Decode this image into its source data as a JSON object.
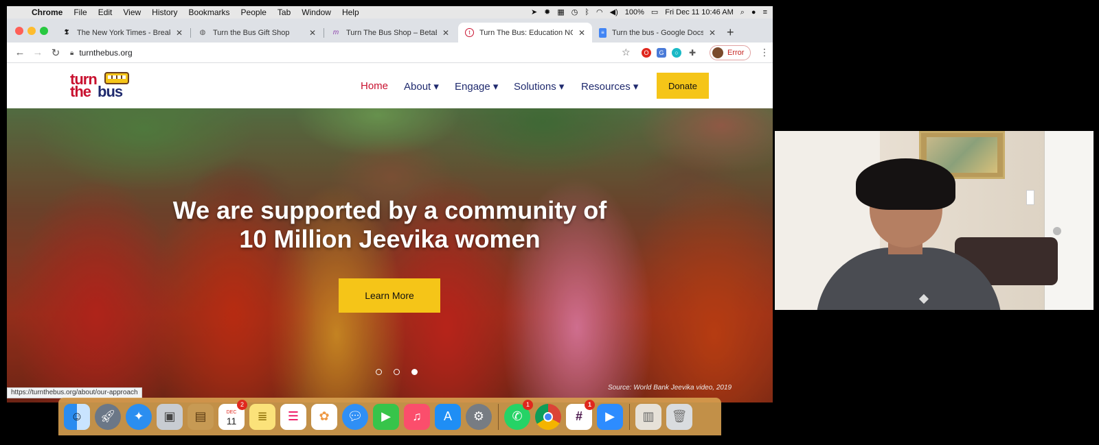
{
  "menubar": {
    "app": "Chrome",
    "items": [
      "File",
      "Edit",
      "View",
      "History",
      "Bookmarks",
      "People",
      "Tab",
      "Window",
      "Help"
    ],
    "battery": "100%",
    "clock": "Fri Dec 11  10:46 AM"
  },
  "browser": {
    "tabs": [
      {
        "title": "The New York Times - Breaking",
        "icon": "nyt-icon"
      },
      {
        "title": "Turn the Bus Gift Shop",
        "icon": "globe-icon"
      },
      {
        "title": "Turn The Bus Shop – BetaBus",
        "icon": "m-logo-icon"
      },
      {
        "title": "Turn The Bus: Education NGO",
        "icon": "turnthebus-icon"
      },
      {
        "title": "Turn the bus - Google Docs",
        "icon": "docs-icon"
      }
    ],
    "active_tab": 3,
    "url": "turnthebus.org",
    "profile_label": "Error",
    "status_url": "https://turnthebus.org/about/our-approach"
  },
  "site": {
    "logo_line1": "turn",
    "logo_line2a": "the",
    "logo_line2b": "bus",
    "nav": [
      {
        "label": "Home",
        "dropdown": ""
      },
      {
        "label": "About",
        "dropdown": "▾"
      },
      {
        "label": "Engage",
        "dropdown": "▾"
      },
      {
        "label": "Solutions",
        "dropdown": "▾"
      },
      {
        "label": "Resources",
        "dropdown": "▾"
      }
    ],
    "donate": "Donate",
    "hero": {
      "line1": "We are supported by a community of",
      "line2": "10 Million Jeevika women",
      "cta": "Learn More",
      "active_slide": 3,
      "slide_count": 3,
      "source": "Source: World Bank Jeevika video, 2019"
    }
  },
  "dock": {
    "calendar_month": "DEC",
    "calendar_day": "11",
    "calendar_badge": "2",
    "whatsapp_badge": "1",
    "slack_badge": "1"
  },
  "colors": {
    "brand_red": "#c8102e",
    "brand_navy": "#1f2a6e",
    "brand_yellow": "#f5c518"
  }
}
